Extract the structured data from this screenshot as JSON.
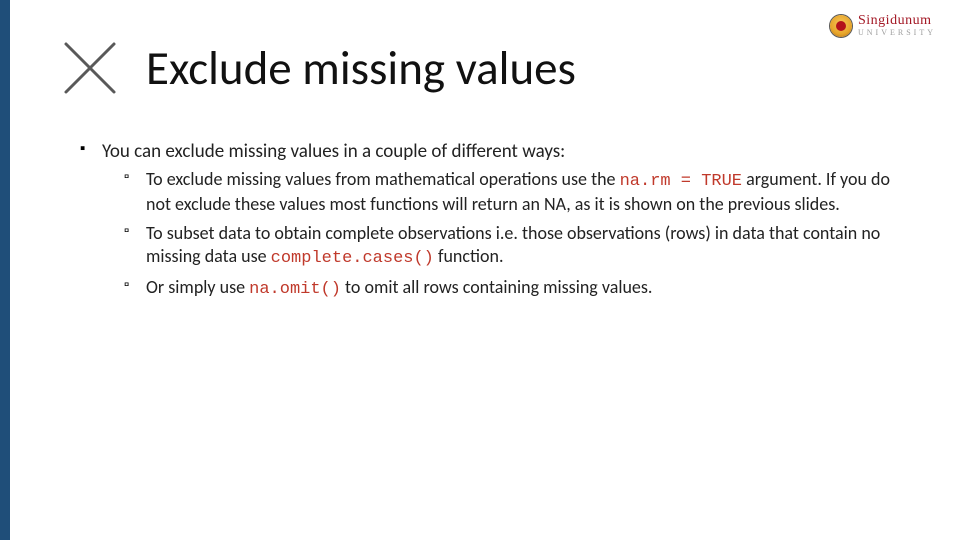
{
  "brand": {
    "name": "Singidunum",
    "sub": "UNIVERSITY"
  },
  "title": "Exclude missing values",
  "content": {
    "lead": "You can exclude missing values in a couple of different ways:",
    "items": [
      {
        "pre": "To exclude missing values from mathematical operations use the ",
        "code": "na.rm = TRUE",
        "post": " argument. If you do not exclude these values most functions will return an NA, as it is shown on the previous slides."
      },
      {
        "pre": "To subset data to obtain complete observations i.e. those observations (rows) in data that contain no missing data use ",
        "code": "complete.cases()",
        "post": " function."
      },
      {
        "pre": "Or simply use ",
        "code": "na.omit()",
        "post": " to omit all rows containing missing values."
      }
    ]
  }
}
